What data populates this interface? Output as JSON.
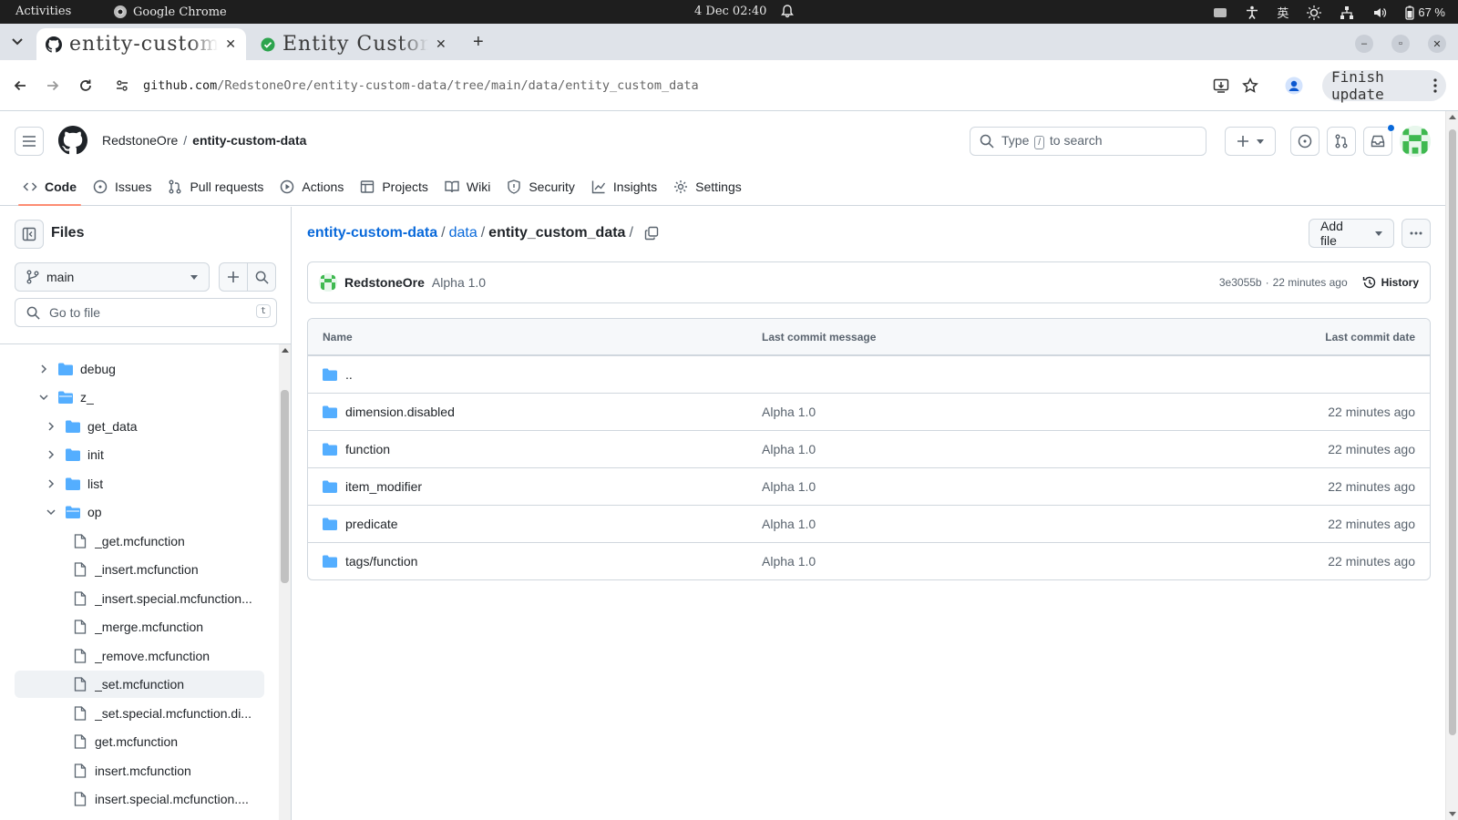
{
  "os": {
    "activities": "Activities",
    "app_name": "Google Chrome",
    "clock": "4 Dec 02:40",
    "ime": "英",
    "battery": "67 %"
  },
  "browser": {
    "tabs": [
      {
        "title": "entity-custom-data/data/entity_custom_data at main · RedstoneOre/entity-custom-data",
        "active": true
      },
      {
        "title": "Entity Custom Data",
        "active": false
      }
    ],
    "url_host": "github.com",
    "url_path": "/RedstoneOre/entity-custom-data/tree/main/data/entity_custom_data",
    "finish_update": "Finish update"
  },
  "header": {
    "owner": "RedstoneOre",
    "separator": "/",
    "repo": "entity-custom-data",
    "search_prefix": "Type",
    "search_key": "/",
    "search_suffix": "to search"
  },
  "nav": {
    "items": [
      {
        "label": "Code",
        "icon": "code-icon"
      },
      {
        "label": "Issues",
        "icon": "issue-icon"
      },
      {
        "label": "Pull requests",
        "icon": "pull-request-icon"
      },
      {
        "label": "Actions",
        "icon": "play-icon"
      },
      {
        "label": "Projects",
        "icon": "table-icon"
      },
      {
        "label": "Wiki",
        "icon": "book-icon"
      },
      {
        "label": "Security",
        "icon": "shield-icon"
      },
      {
        "label": "Insights",
        "icon": "graph-icon"
      },
      {
        "label": "Settings",
        "icon": "gear-icon"
      }
    ]
  },
  "sidebar": {
    "title": "Files",
    "branch": "main",
    "goto_placeholder": "Go to file",
    "goto_key": "t",
    "tree": [
      {
        "label": "debug",
        "type": "folder",
        "depth": 1,
        "expanded": false
      },
      {
        "label": "z_",
        "type": "folder",
        "depth": 1,
        "expanded": true
      },
      {
        "label": "get_data",
        "type": "folder",
        "depth": 2,
        "expanded": false
      },
      {
        "label": "init",
        "type": "folder",
        "depth": 2,
        "expanded": false
      },
      {
        "label": "list",
        "type": "folder",
        "depth": 2,
        "expanded": false
      },
      {
        "label": "op",
        "type": "folder",
        "depth": 2,
        "expanded": true
      },
      {
        "label": "_get.mcfunction",
        "type": "file",
        "depth": 3
      },
      {
        "label": "_insert.mcfunction",
        "type": "file",
        "depth": 3
      },
      {
        "label": "_insert.special.mcfunction...",
        "type": "file",
        "depth": 3
      },
      {
        "label": "_merge.mcfunction",
        "type": "file",
        "depth": 3
      },
      {
        "label": "_remove.mcfunction",
        "type": "file",
        "depth": 3
      },
      {
        "label": "_set.mcfunction",
        "type": "file",
        "depth": 3,
        "active": true
      },
      {
        "label": "_set.special.mcfunction.di...",
        "type": "file",
        "depth": 3
      },
      {
        "label": "get.mcfunction",
        "type": "file",
        "depth": 3
      },
      {
        "label": "insert.mcfunction",
        "type": "file",
        "depth": 3
      },
      {
        "label": "insert.special.mcfunction....",
        "type": "file",
        "depth": 3
      }
    ]
  },
  "main": {
    "breadcrumb": {
      "repo": "entity-custom-data",
      "sep1": "/",
      "dir": "data",
      "sep2": "/",
      "current": "entity_custom_data",
      "sep3": "/"
    },
    "add_file": "Add file",
    "commit": {
      "author": "RedstoneOre",
      "message": "Alpha 1.0",
      "sha": "3e3055b",
      "dot": "·",
      "time": "22 minutes ago",
      "history": "History"
    },
    "table": {
      "headers": {
        "name": "Name",
        "message": "Last commit message",
        "date": "Last commit date"
      },
      "parent": "..",
      "rows": [
        {
          "name": "dimension.disabled",
          "message": "Alpha 1.0",
          "date": "22 minutes ago"
        },
        {
          "name": "function",
          "message": "Alpha 1.0",
          "date": "22 minutes ago"
        },
        {
          "name": "item_modifier",
          "message": "Alpha 1.0",
          "date": "22 minutes ago"
        },
        {
          "name": "predicate",
          "message": "Alpha 1.0",
          "date": "22 minutes ago"
        },
        {
          "name": "tags/function",
          "message": "Alpha 1.0",
          "date": "22 minutes ago"
        }
      ]
    }
  },
  "colors": {
    "link": "#0969da",
    "folder": "#54aeff",
    "accent_underline": "#fd8c73",
    "border": "#d0d7de"
  }
}
